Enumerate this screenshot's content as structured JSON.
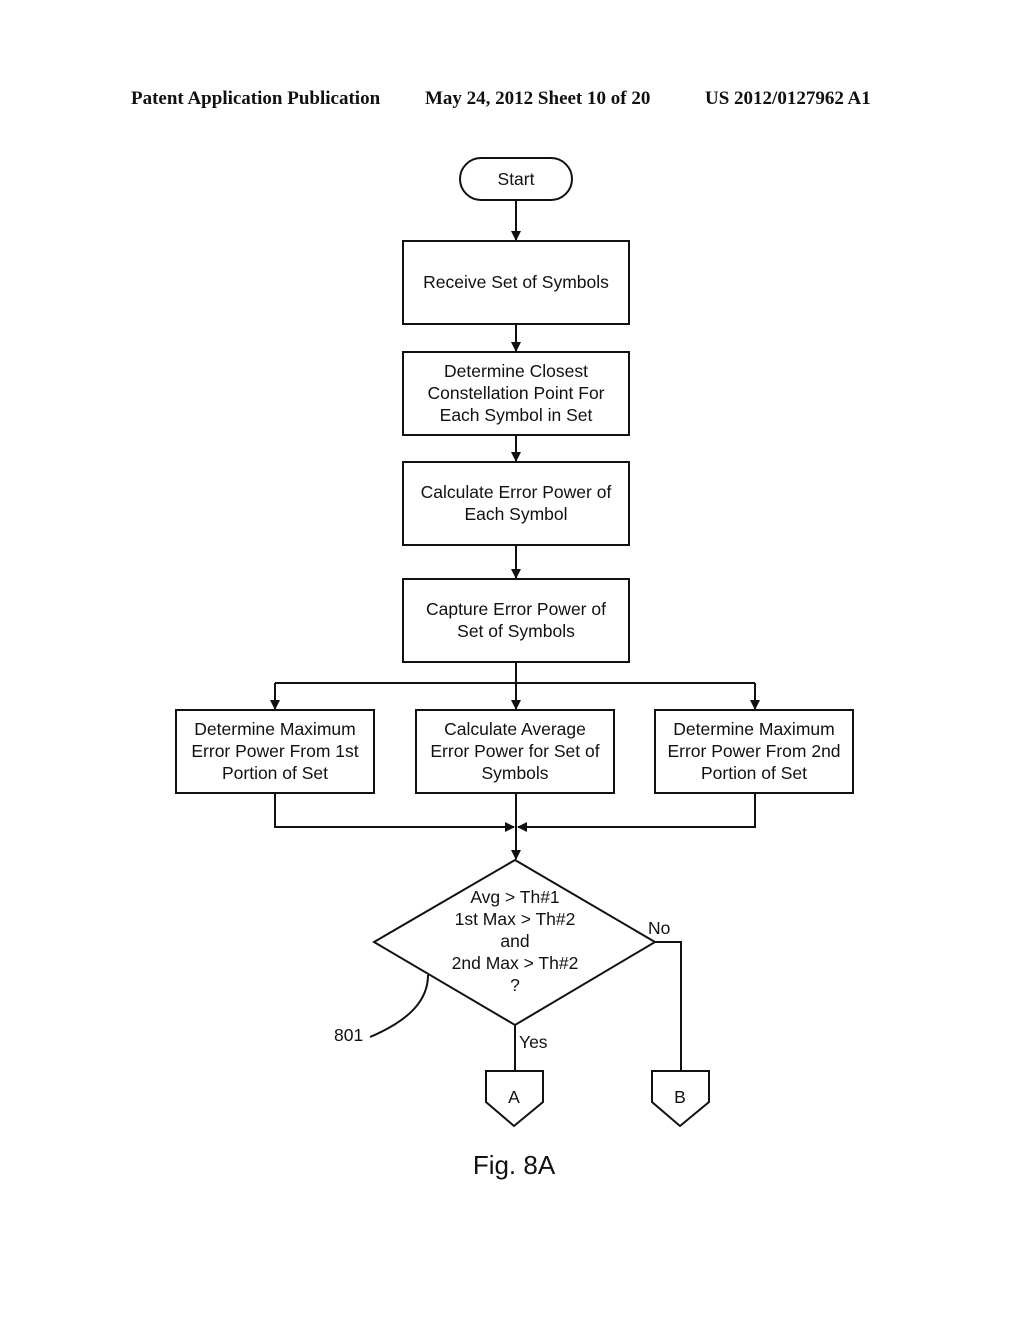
{
  "header": {
    "publication": "Patent Application Publication",
    "date_sheet": "May 24, 2012  Sheet 10 of 20",
    "number": "US 2012/0127962 A1"
  },
  "flowchart": {
    "start": "Start",
    "steps": [
      [
        "Receive Set of Symbols"
      ],
      [
        "Determine Closest",
        "Constellation Point For",
        "Each Symbol in Set"
      ],
      [
        "Calculate Error Power of",
        "Each Symbol"
      ],
      [
        "Capture Error Power of",
        "Set of Symbols"
      ]
    ],
    "parallel": [
      [
        "Determine Maximum",
        "Error Power From 1st",
        "Portion of Set"
      ],
      [
        "Calculate Average",
        "Error Power for Set of",
        "Symbols"
      ],
      [
        "Determine Maximum",
        "Error Power From 2nd",
        "Portion of Set"
      ]
    ],
    "decision": [
      "Avg > Th#1",
      "1st Max > Th#2",
      "and",
      "2nd Max > Th#2",
      "?"
    ],
    "yes_label": "Yes",
    "no_label": "No",
    "connector_a": "A",
    "connector_b": "B",
    "reference": "801"
  },
  "figure_label": "Fig. 8A"
}
